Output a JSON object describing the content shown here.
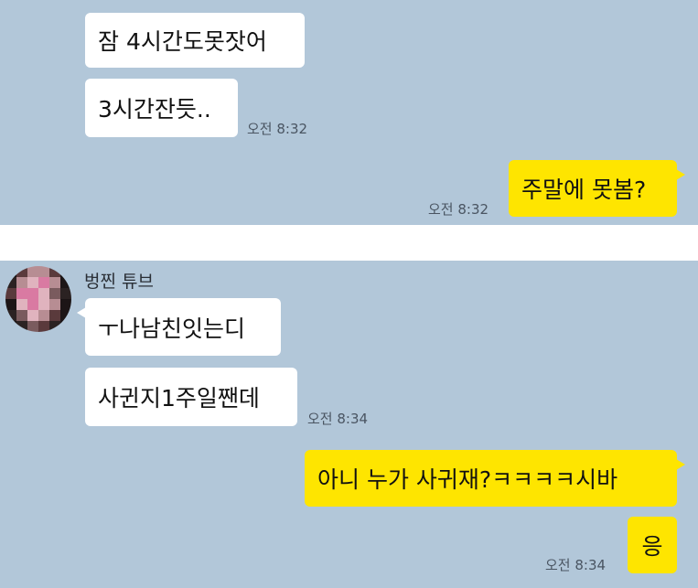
{
  "chat_top": {
    "messages": [
      {
        "side": "in",
        "text": "잠 4시간도못잣어"
      },
      {
        "side": "in",
        "text": "3시간잔듯..",
        "time": "오전 8:32"
      },
      {
        "side": "out",
        "text": "주말에 못봄?",
        "time": "오전 8:32"
      }
    ]
  },
  "chat_bottom": {
    "sender_name": "벙찐 튜브",
    "avatar": {
      "icon": "blurred-profile-photo-icon",
      "colors": [
        "#2b2222",
        "#5a3a3c",
        "#b78d93",
        "#d97aa2",
        "#e0b3be",
        "#7a5b5e",
        "#1c1516"
      ]
    },
    "messages": [
      {
        "side": "in",
        "text": "ㅜ나남친잇는디"
      },
      {
        "side": "in",
        "text": "사귄지1주일짼데",
        "time": "오전 8:34"
      },
      {
        "side": "out",
        "text": "아니 누가 사귀재?ㅋㅋㅋㅋ시바"
      },
      {
        "side": "out",
        "text": "응",
        "time": "오전 8:34"
      }
    ]
  },
  "colors": {
    "chat_background": "#b2c7d9",
    "outgoing_bubble": "#fee500",
    "incoming_bubble": "#ffffff"
  }
}
